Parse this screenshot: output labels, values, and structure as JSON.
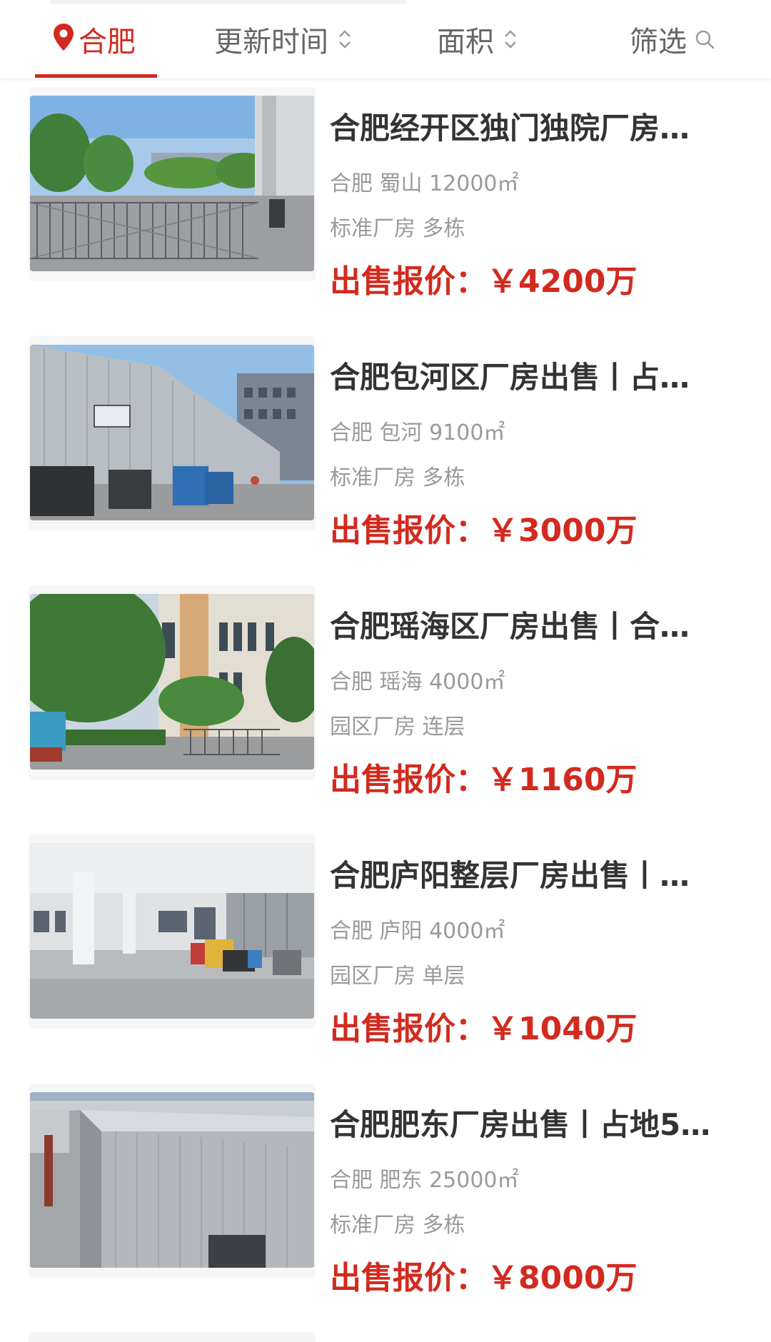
{
  "tabs": {
    "city": "合肥",
    "update_time": "更新时间",
    "area": "面积",
    "filter": "筛选"
  },
  "colors": {
    "accent": "#d22a1f",
    "text_primary": "#333333",
    "text_secondary": "#9a9a9a"
  },
  "listings": [
    {
      "title": "合肥经开区独门独院厂房…",
      "meta": "合肥 蜀山 12000㎡",
      "tags": "标准厂房 多栋",
      "price": "出售报价：￥4200万",
      "image": "factory-gate-photo"
    },
    {
      "title": "合肥包河区厂房出售丨占…",
      "meta": "合肥 包河 9100㎡",
      "tags": "标准厂房 多栋",
      "price": "出售报价：￥3000万",
      "image": "warehouse-exterior-photo"
    },
    {
      "title": "合肥瑶海区厂房出售丨合…",
      "meta": "合肥 瑶海 4000㎡",
      "tags": "园区厂房 连层",
      "price": "出售报价：￥1160万",
      "image": "industrial-park-photo"
    },
    {
      "title": "合肥庐阳整层厂房出售丨…",
      "meta": "合肥 庐阳 4000㎡",
      "tags": "园区厂房 单层",
      "price": "出售报价：￥1040万",
      "image": "empty-floor-interior-photo"
    },
    {
      "title": "合肥肥东厂房出售丨占地5…",
      "meta": "合肥 肥东 25000㎡",
      "tags": "标准厂房 多栋",
      "price": "出售报价：￥8000万",
      "image": "steel-roof-factory-photo"
    }
  ]
}
